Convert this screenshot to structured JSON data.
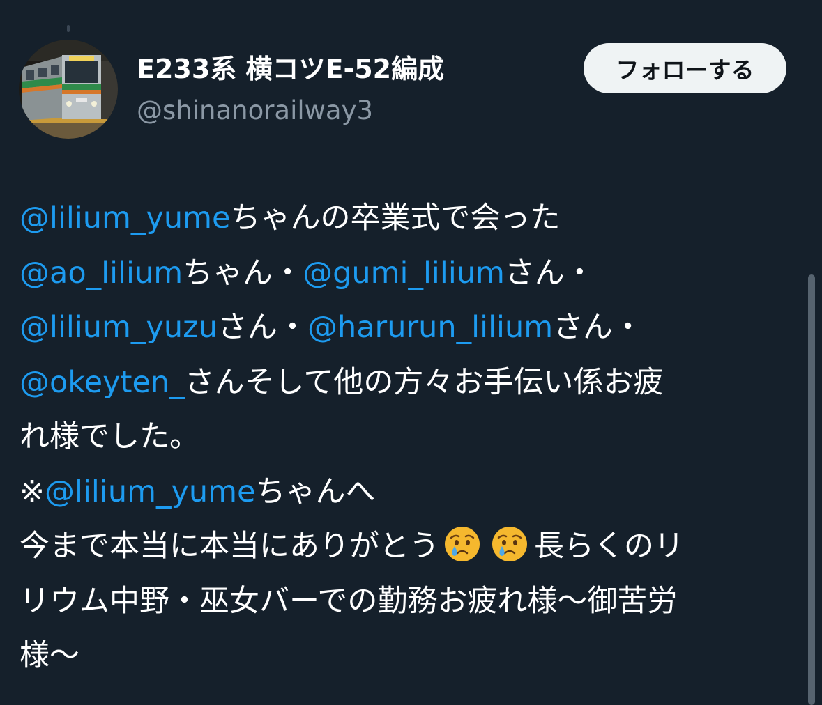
{
  "tweet": {
    "author": {
      "display_name": "E233系 横コツE-52編成",
      "handle": "@shinanorailway3",
      "avatar_icon": "train-photo-avatar"
    },
    "follow_button_label": "フォローする",
    "lines": [
      [
        {
          "type": "mention",
          "text": "@lilium_yume"
        },
        {
          "type": "text",
          "text": "ちゃんの卒業式で会った"
        }
      ],
      [
        {
          "type": "mention",
          "text": "@ao_lilium"
        },
        {
          "type": "text",
          "text": "ちゃん・"
        },
        {
          "type": "mention",
          "text": "@gumi_lilium"
        },
        {
          "type": "text",
          "text": "さん・"
        }
      ],
      [
        {
          "type": "mention",
          "text": "@lilium_yuzu"
        },
        {
          "type": "text",
          "text": "さん・"
        },
        {
          "type": "mention",
          "text": "@harurun_lilium"
        },
        {
          "type": "text",
          "text": "さん・"
        }
      ],
      [
        {
          "type": "mention",
          "text": "@okeyten_"
        },
        {
          "type": "text",
          "text": "さんそして他の方々お手伝い係お疲"
        }
      ],
      [
        {
          "type": "text",
          "text": "れ様でした。"
        }
      ],
      [
        {
          "type": "text",
          "text": "※"
        },
        {
          "type": "mention",
          "text": "@lilium_yume"
        },
        {
          "type": "text",
          "text": "ちゃんへ"
        }
      ],
      [
        {
          "type": "text",
          "text": "今まで本当に本当にありがとう"
        },
        {
          "type": "emoji",
          "name": "crying-face-emoji"
        },
        {
          "type": "emoji",
          "name": "crying-face-emoji"
        },
        {
          "type": "text",
          "text": "長らくのリ"
        }
      ],
      [
        {
          "type": "text",
          "text": "リウム中野・巫女バーでの勤務お疲れ様〜御苦労"
        }
      ],
      [
        {
          "type": "text",
          "text": "様〜"
        }
      ]
    ]
  },
  "colors": {
    "background": "#15202b",
    "mention": "#1d9bf0",
    "secondary_text": "#8b98a5",
    "follow_button_bg": "#eff3f4"
  }
}
